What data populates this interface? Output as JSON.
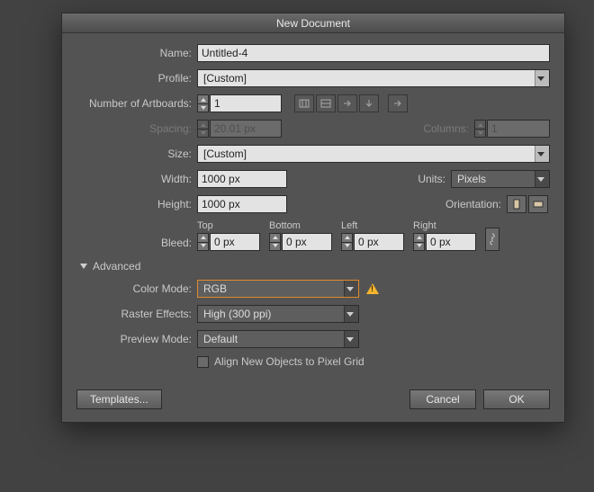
{
  "title": "New Document",
  "labels": {
    "name": "Name:",
    "profile": "Profile:",
    "artboards": "Number of Artboards:",
    "spacing": "Spacing:",
    "columns": "Columns:",
    "size": "Size:",
    "width": "Width:",
    "height": "Height:",
    "units": "Units:",
    "orientation": "Orientation:",
    "bleed": "Bleed:",
    "colorMode": "Color Mode:",
    "rasterEffects": "Raster Effects:",
    "previewMode": "Preview Mode:"
  },
  "values": {
    "name": "Untitled-4",
    "profile": "[Custom]",
    "artboards": "1",
    "spacing": "20.01 px",
    "columns": "1",
    "size": "[Custom]",
    "width": "1000 px",
    "height": "1000 px",
    "units": "Pixels",
    "colorMode": "RGB",
    "rasterEffects": "High (300 ppi)",
    "previewMode": "Default"
  },
  "bleed": {
    "topLabel": "Top",
    "bottomLabel": "Bottom",
    "leftLabel": "Left",
    "rightLabel": "Right",
    "top": "0 px",
    "bottom": "0 px",
    "left": "0 px",
    "right": "0 px"
  },
  "advanced": "Advanced",
  "alignToGrid": "Align New Objects to Pixel Grid",
  "buttons": {
    "templates": "Templates...",
    "cancel": "Cancel",
    "ok": "OK"
  }
}
